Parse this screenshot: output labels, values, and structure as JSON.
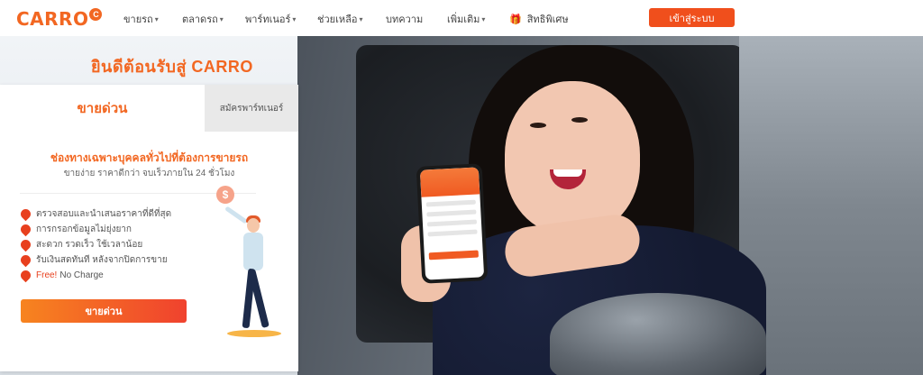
{
  "header": {
    "logo": "CARRO",
    "nav": [
      {
        "label": "ขายรถ",
        "dropdown": true
      },
      {
        "label": "ตลาดรถ",
        "dropdown": true
      },
      {
        "label": "พาร์ทเนอร์",
        "dropdown": true
      },
      {
        "label": "ช่วยเหลือ",
        "dropdown": true
      },
      {
        "label": "บทความ",
        "dropdown": false
      },
      {
        "label": "เพิ่มเติม",
        "dropdown": true
      },
      {
        "label": "สิทธิพิเศษ",
        "dropdown": false,
        "icon": "gift-icon"
      }
    ],
    "login_label": "เข้าสู่ระบบ"
  },
  "hero": {
    "welcome": "ยินดีต้อนรับสู่ CARRO"
  },
  "card": {
    "tabs": [
      {
        "label": "ขายด่วน",
        "active": true
      },
      {
        "label": "สมัครพาร์ทเนอร์",
        "active": false
      }
    ],
    "headline": "ช่องทางเฉพาะบุคคลทั่วไปที่ต้องการขายรถ",
    "subheadline": "ขายง่าย ราคาดีกว่า จบเร็วภายใน 24 ชั่วโมง",
    "features": [
      "ตรวจสอบและนำเสนอราคาที่ดีที่สุด",
      "การกรอกข้อมูลไม่ยุ่งยาก",
      "สะดวก รวดเร็ว ใช้เวลาน้อย",
      "รับเงินสดทันที หลังจากปิดการขาย"
    ],
    "free_label": "Free!",
    "free_text": "No Charge",
    "cta_label": "ขายด่วน"
  },
  "colors": {
    "brand": "#f26722",
    "button": "#f04f1c"
  }
}
